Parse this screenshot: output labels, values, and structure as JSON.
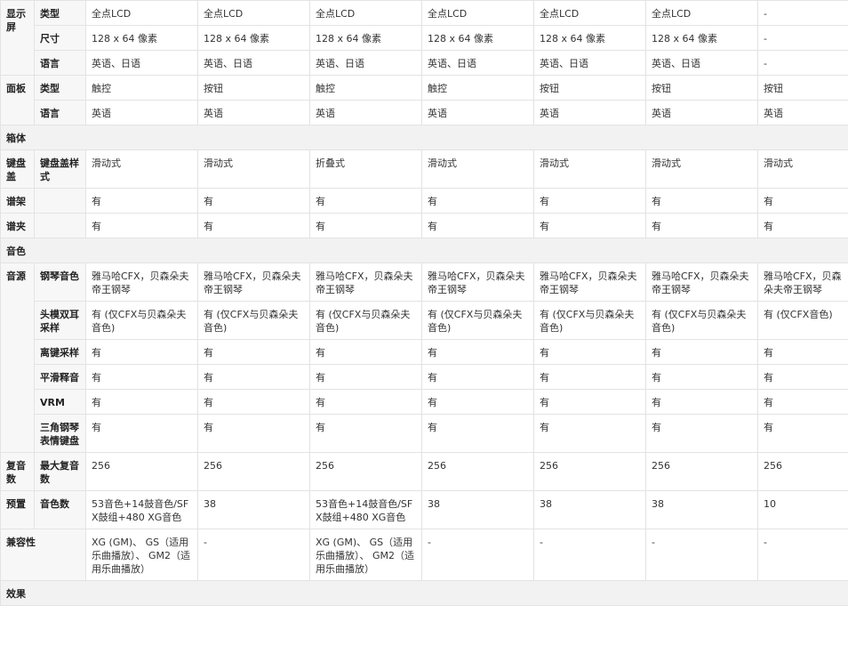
{
  "groups": {
    "display": "显示屏",
    "panel": "面板",
    "cabinet": "箱体",
    "key_cover": "键盘盖",
    "music_rest": "谱架",
    "music_clip": "谱夹",
    "voice": "音色",
    "tone": "音源",
    "polyphony": "复音数",
    "preset": "预置",
    "compat": "兼容性",
    "effects": "效果"
  },
  "rows": {
    "display_type": {
      "label": "类型",
      "values": [
        "全点LCD",
        "全点LCD",
        "全点LCD",
        "全点LCD",
        "全点LCD",
        "全点LCD",
        "-"
      ]
    },
    "display_size": {
      "label": "尺寸",
      "values": [
        "128 x 64 像素",
        "128 x 64 像素",
        "128 x 64 像素",
        "128 x 64 像素",
        "128 x 64 像素",
        "128 x 64 像素",
        "-"
      ]
    },
    "display_lang": {
      "label": "语言",
      "values": [
        "英语、日语",
        "英语、日语",
        "英语、日语",
        "英语、日语",
        "英语、日语",
        "英语、日语",
        "-"
      ]
    },
    "panel_type": {
      "label": "类型",
      "values": [
        "触控",
        "按钮",
        "触控",
        "触控",
        "按钮",
        "按钮",
        "按钮"
      ]
    },
    "panel_lang": {
      "label": "语言",
      "values": [
        "英语",
        "英语",
        "英语",
        "英语",
        "英语",
        "英语",
        "英语"
      ]
    },
    "key_cover_style": {
      "label": "键盘盖样式",
      "values": [
        "滑动式",
        "滑动式",
        "折叠式",
        "滑动式",
        "滑动式",
        "滑动式",
        "滑动式"
      ]
    },
    "music_rest": {
      "values": [
        "有",
        "有",
        "有",
        "有",
        "有",
        "有",
        "有"
      ]
    },
    "music_clip": {
      "values": [
        "有",
        "有",
        "有",
        "有",
        "有",
        "有",
        "有"
      ]
    },
    "piano_sound": {
      "label": "钢琴音色",
      "values": [
        "雅马哈CFX，贝森朵夫帝王钢琴",
        "雅马哈CFX，贝森朵夫帝王钢琴",
        "雅马哈CFX，贝森朵夫帝王钢琴",
        "雅马哈CFX，贝森朵夫帝王钢琴",
        "雅马哈CFX，贝森朵夫帝王钢琴",
        "雅马哈CFX，贝森朵夫帝王钢琴",
        "雅马哈CFX，贝森朵夫帝王钢琴"
      ]
    },
    "binaural": {
      "label": "头模双耳采样",
      "values": [
        "有 (仅CFX与贝森朵夫音色)",
        "有 (仅CFX与贝森朵夫音色)",
        "有 (仅CFX与贝森朵夫音色)",
        "有 (仅CFX与贝森朵夫音色)",
        "有 (仅CFX与贝森朵夫音色)",
        "有 (仅CFX与贝森朵夫音色)",
        "有 (仅CFX音色)"
      ]
    },
    "key_off": {
      "label": "离键采样",
      "values": [
        "有",
        "有",
        "有",
        "有",
        "有",
        "有",
        "有"
      ]
    },
    "smooth_release": {
      "label": "平滑释音",
      "values": [
        "有",
        "有",
        "有",
        "有",
        "有",
        "有",
        "有"
      ]
    },
    "vrm": {
      "label": "VRM",
      "values": [
        "有",
        "有",
        "有",
        "有",
        "有",
        "有",
        "有"
      ]
    },
    "grand_expr": {
      "label": "三角钢琴表情键盘",
      "values": [
        "有",
        "有",
        "有",
        "有",
        "有",
        "有",
        "有"
      ]
    },
    "max_poly": {
      "label": "最大复音数",
      "values": [
        "256",
        "256",
        "256",
        "256",
        "256",
        "256",
        "256"
      ]
    },
    "voice_count": {
      "label": "音色数",
      "values": [
        "53音色+14鼓音色/SFX鼓组+480 XG音色",
        "38",
        "53音色+14鼓音色/SFX鼓组+480 XG音色",
        "38",
        "38",
        "38",
        "10"
      ]
    },
    "compat": {
      "values": [
        "XG (GM)、 GS（适用乐曲播放）、 GM2（适用乐曲播放）",
        "-",
        "XG (GM)、 GS（适用乐曲播放）、 GM2（适用乐曲播放）",
        "-",
        "-",
        "-",
        "-"
      ]
    }
  }
}
